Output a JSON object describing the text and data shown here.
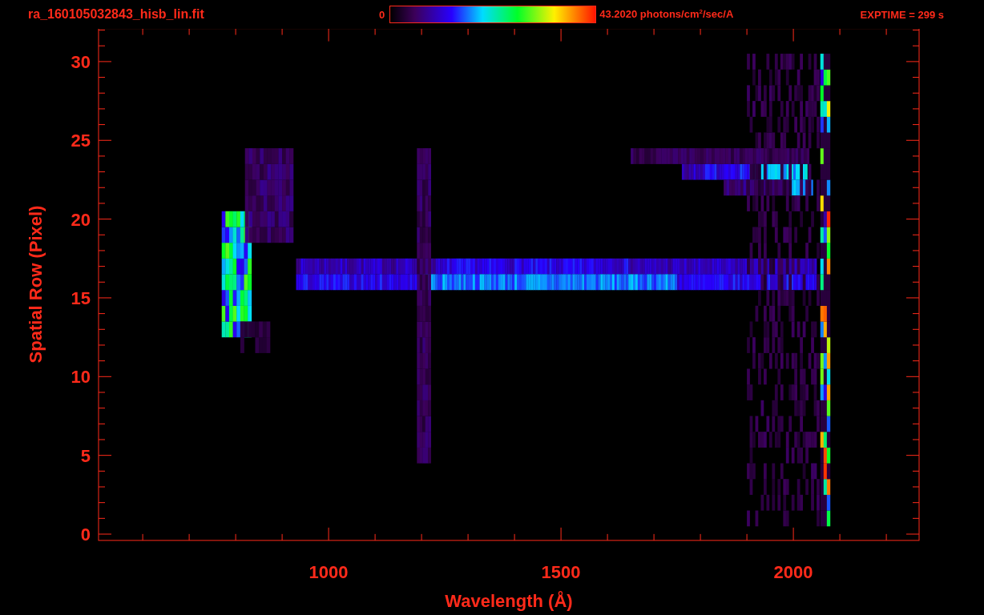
{
  "header": {
    "file_name": "ra_160105032843_hisb_lin.fit",
    "colorbar": {
      "min_label": "0",
      "max_label": "43.2020 photons/cm$^{2}$/sec/A"
    },
    "exposure": "EXPTIME = 299 s"
  },
  "plot": {
    "x_axis": {
      "title": "Wavelength (Å)",
      "tick_labels": [
        "1000",
        "1500",
        "2000"
      ]
    },
    "y_axis": {
      "title": "Spatial Row (Pixel)",
      "tick_labels": [
        "30",
        "25",
        "20",
        "15",
        "10",
        "5",
        "0"
      ]
    }
  }
}
